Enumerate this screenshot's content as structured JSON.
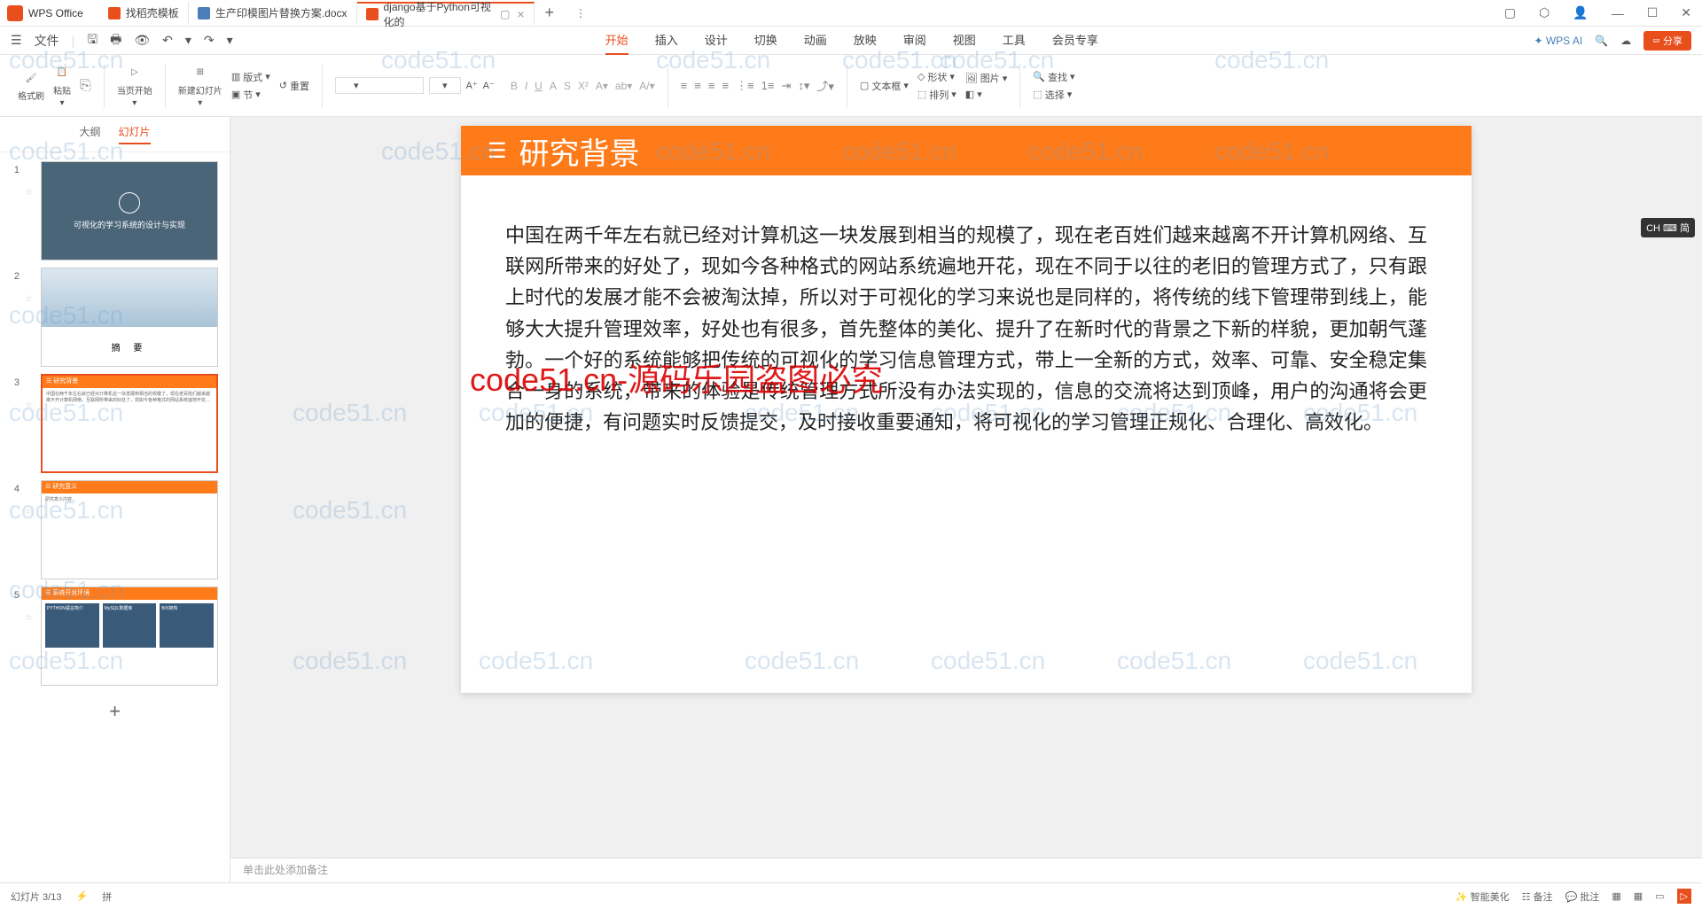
{
  "app": {
    "name": "WPS Office"
  },
  "tabs": [
    {
      "label": "找稻壳模板",
      "type": "p"
    },
    {
      "label": "生产印模图片替换方案.docx",
      "type": "w"
    },
    {
      "label": "django基于Python可视化的",
      "type": "p",
      "active": true
    }
  ],
  "menu": {
    "file": "文件",
    "items": [
      "开始",
      "插入",
      "设计",
      "切换",
      "动画",
      "放映",
      "审阅",
      "视图",
      "工具",
      "会员专享"
    ],
    "active": "开始",
    "ai": "WPS AI",
    "share": "分享"
  },
  "ribbon": {
    "format_painter": "格式刷",
    "paste": "粘贴",
    "from_current": "当页开始",
    "new_slide": "新建幻灯片",
    "layout": "版式",
    "section": "节",
    "reset": "重置",
    "text_box": "文本框",
    "shape": "形状",
    "arrange": "排列",
    "picture": "图片",
    "find": "查找",
    "select": "选择"
  },
  "panel": {
    "outline": "大纲",
    "slides": "幻灯片"
  },
  "thumbs": {
    "t1": "可视化的学习系统的设计与实现",
    "t2": "摘    要",
    "t3": "研究背景",
    "t4": "研究意义",
    "t5": "系统开发环境",
    "t5a": "PYTHON语言简介",
    "t5b": "MySQL数据库",
    "t5c": "B/S架构"
  },
  "slide": {
    "title": "研究背景",
    "body": "中国在两千年左右就已经对计算机这一块发展到相当的规模了，现在老百姓们越来越离不开计算机网络、互联网所带来的好处了，现如今各种格式的网站系统遍地开花，现在不同于以往的老旧的管理方式了，只有跟上时代的发展才能不会被淘汰掉，所以对于可视化的学习来说也是同样的，将传统的线下管理带到线上，能够大大提升管理效率，好处也有很多，首先整体的美化、提升了在新时代的背景之下新的样貌，更加朝气蓬勃。一个好的系统能够把传统的可视化的学习信息管理方式，带上一全新的方式，效率、可靠、安全稳定集合一身的系统，带来的体验是传统管理方式所没有办法实现的，信息的交流将达到顶峰，用户的沟通将会更加的便捷，有问题实时反馈提交，及时接收重要通知，将可视化的学习管理正规化、合理化、高效化。"
  },
  "notes": "单击此处添加备注",
  "ime": "CH ⌨ 简",
  "watermark": "code51.cn",
  "watermark_red": "code51.cn-源码乐园盗图必究",
  "status": {
    "left": "幻灯片 3/13",
    "smart": "智能美化",
    "notes_btn": "备注",
    "comments": "批注"
  }
}
